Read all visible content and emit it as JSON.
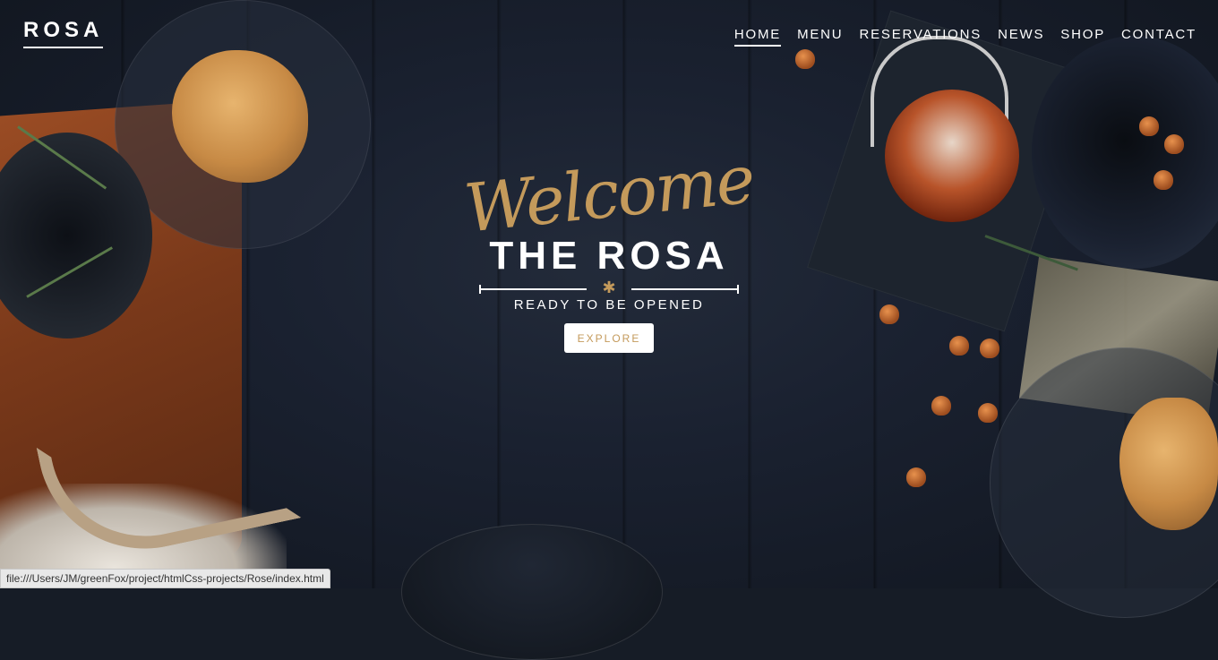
{
  "header": {
    "logo": "ROSA",
    "nav": [
      {
        "label": "HOME",
        "active": true
      },
      {
        "label": "MENU",
        "active": false
      },
      {
        "label": "RESERVATIONS",
        "active": false
      },
      {
        "label": "NEWS",
        "active": false
      },
      {
        "label": "SHOP",
        "active": false
      },
      {
        "label": "CONTACT",
        "active": false
      }
    ]
  },
  "hero": {
    "welcome": "Welcome",
    "title": "THE ROSA",
    "divider_icon": "asterisk-icon",
    "tagline": "READY TO BE OPENED",
    "cta": "EXPLORE"
  },
  "status_bar": {
    "url": "file:///Users/JM/greenFox/project/htmlCss-projects/Rose/index.html"
  },
  "colors": {
    "accent": "#c49a5b",
    "text": "#ffffff",
    "background": "#161c26"
  }
}
